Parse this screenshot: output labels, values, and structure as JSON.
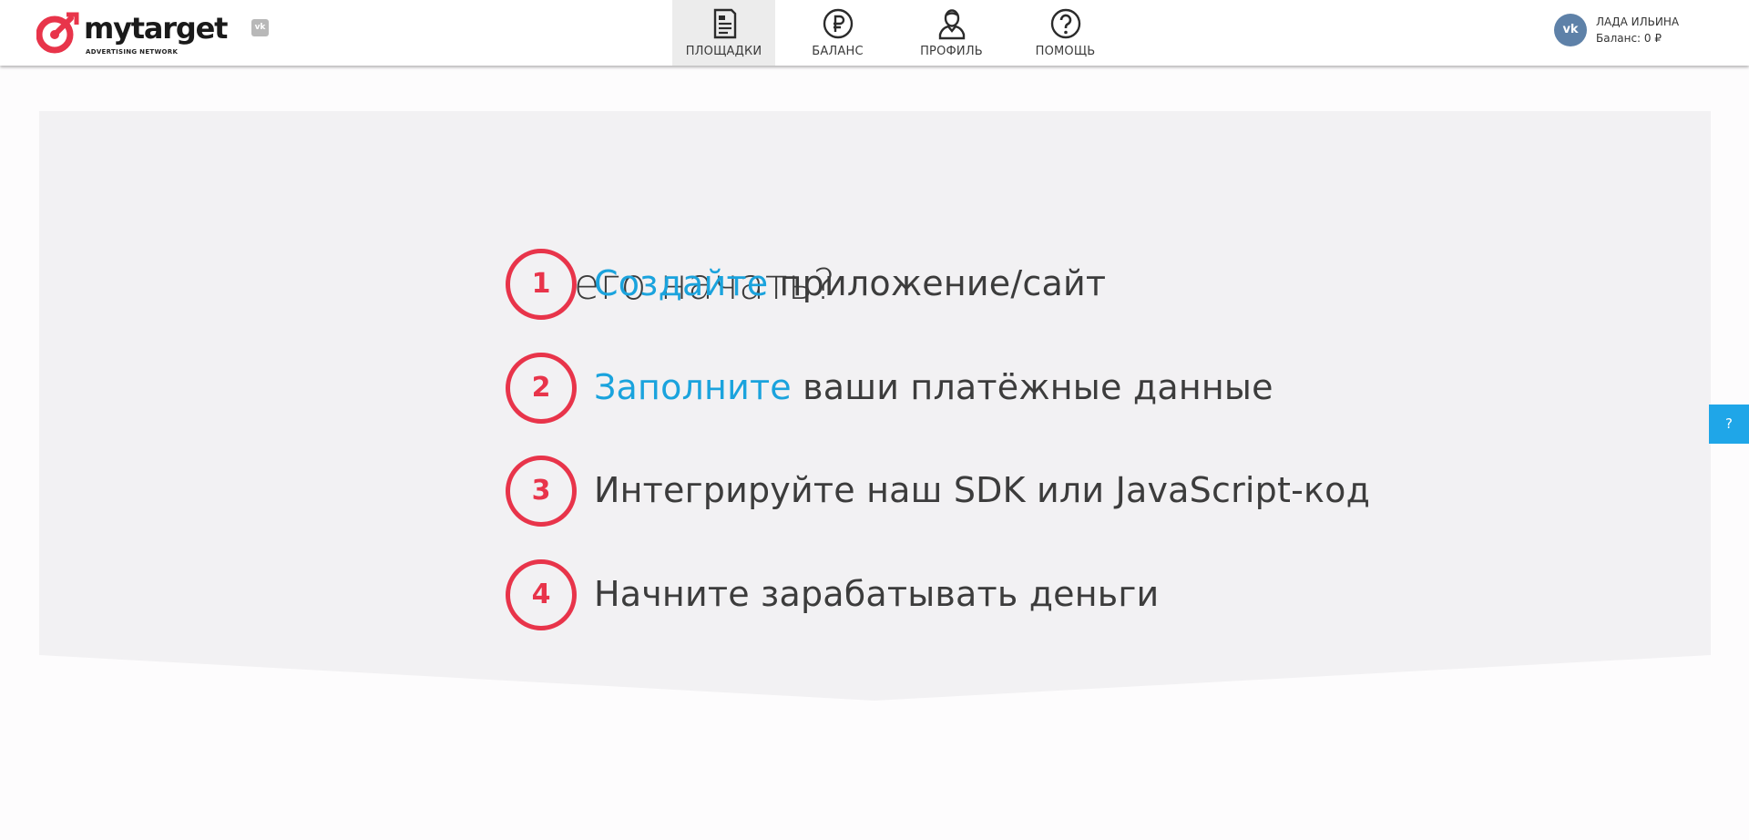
{
  "header": {
    "logo": {
      "wordmark": "mytarget",
      "tagline": "ADVERTISING NETWORK",
      "vk_badge": "vk",
      "brand_color": "#e8344a"
    },
    "nav": [
      {
        "label": "ПЛОЩАДКИ",
        "icon": "document-list-icon",
        "active": true
      },
      {
        "label": "БАЛАНС",
        "icon": "ruble-coin-icon",
        "active": false
      },
      {
        "label": "ПРОФИЛЬ",
        "icon": "user-profile-icon",
        "active": false
      },
      {
        "label": "ПОМОЩЬ",
        "icon": "question-circle-icon",
        "active": false
      }
    ],
    "user": {
      "avatar": "vk",
      "name": "ЛАДА ИЛЬИНА",
      "balance": "Баланс: 0 ₽"
    }
  },
  "main": {
    "title": "С чего начать?",
    "steps": [
      {
        "number": "1",
        "link": "Создайте",
        "text": " приложение/сайт"
      },
      {
        "number": "2",
        "link": "Заполните",
        "text": " ваши платёжные данные"
      },
      {
        "number": "3",
        "link": "",
        "text": "Интегрируйте наш SDK или JavaScript-код"
      },
      {
        "number": "4",
        "link": "",
        "text": "Начните зарабатывать деньги"
      }
    ],
    "colors": {
      "accent_red": "#e8344a",
      "link_blue": "#1aa3dd",
      "panel_bg": "#f2f1f3"
    }
  },
  "help_tab": {
    "label": "?"
  }
}
